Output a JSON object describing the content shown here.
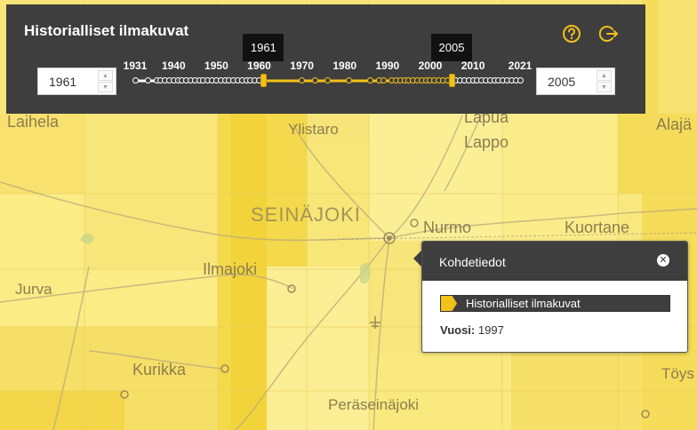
{
  "panel": {
    "title": "Historialliset ilmakuvat",
    "help_icon": "question-circle-icon",
    "exit_icon": "exit-icon",
    "range_start": 1961,
    "range_end": 2005,
    "start_value": "1961",
    "end_value": "2005",
    "tip_start": "1961",
    "tip_end": "2005",
    "axis_min": 1931,
    "axis_max": 2021,
    "ticks": [
      "1931",
      "1940",
      "1950",
      "1960",
      "1970",
      "1980",
      "1990",
      "2000",
      "2010",
      "2021"
    ],
    "available_years": [
      1931,
      1934,
      1936,
      1937,
      1938,
      1939,
      1940,
      1941,
      1942,
      1943,
      1944,
      1945,
      1946,
      1947,
      1948,
      1949,
      1950,
      1951,
      1952,
      1953,
      1954,
      1955,
      1956,
      1957,
      1958,
      1959,
      1960,
      1961,
      1970,
      1973,
      1976,
      1981,
      1986,
      1988,
      1989,
      1991,
      1992,
      1993,
      1994,
      1995,
      1996,
      1997,
      1998,
      1999,
      2000,
      2001,
      2002,
      2003,
      2004,
      2005,
      2006,
      2007,
      2008,
      2009,
      2010,
      2011,
      2012,
      2013,
      2014,
      2015,
      2016,
      2017,
      2018,
      2019,
      2020,
      2021
    ],
    "accent_color": "#f2c21a",
    "panel_color": "#3e3e3e"
  },
  "map": {
    "places": {
      "laihela": "Laihela",
      "ylistaro": "Ylistaro",
      "lapua": "Lapua",
      "lappo": "Lappo",
      "alaja": "Alajä",
      "seinajoki": "SEINÄJOKI",
      "nurmo": "Nurmo",
      "kuortane": "Kuortane",
      "ilmajoki": "Ilmajoki",
      "jurva": "Jurva",
      "kurikka": "Kurikka",
      "peraseinajoki": "Peräseinäjoki",
      "toys": "Töys"
    }
  },
  "popup": {
    "title": "Kohdetiedot",
    "close_icon": "close-icon",
    "layer_name": "Historialliset ilmakuvat",
    "year_label": "Vuosi:",
    "year_value": "1997"
  }
}
